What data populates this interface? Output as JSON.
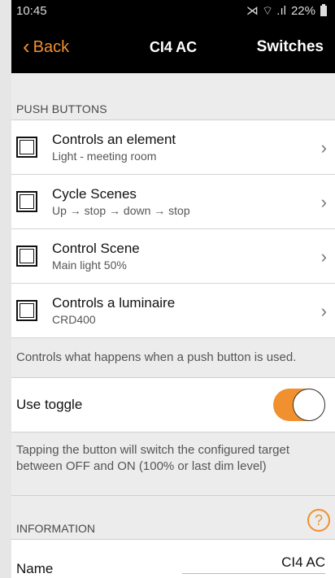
{
  "status": {
    "time": "10:45",
    "signal_text": "⋊ ⌔ .ıl",
    "battery": "22%"
  },
  "nav": {
    "back_label": "Back",
    "title": "CI4 AC",
    "right_label": "Switches"
  },
  "push_buttons": {
    "header": "PUSH BUTTONS",
    "items": [
      {
        "title": "Controls an element",
        "subtitle": "Light - meeting room"
      },
      {
        "title": "Cycle Scenes",
        "subtitle": "Up → stop → down → stop"
      },
      {
        "title": "Control Scene",
        "subtitle": "Main light 50%"
      },
      {
        "title": "Controls a luminaire",
        "subtitle": "CRD400"
      }
    ],
    "note": "Controls what happens when a push button is used."
  },
  "toggle": {
    "label": "Use toggle",
    "on": true,
    "note": "Tapping the button will switch the configured target between OFF and ON (100% or last dim level)"
  },
  "information": {
    "header": "INFORMATION",
    "help": "?",
    "name_label": "Name",
    "name_value": "CI4 AC"
  },
  "colors": {
    "accent": "#f0902e",
    "bar": "#000000"
  }
}
